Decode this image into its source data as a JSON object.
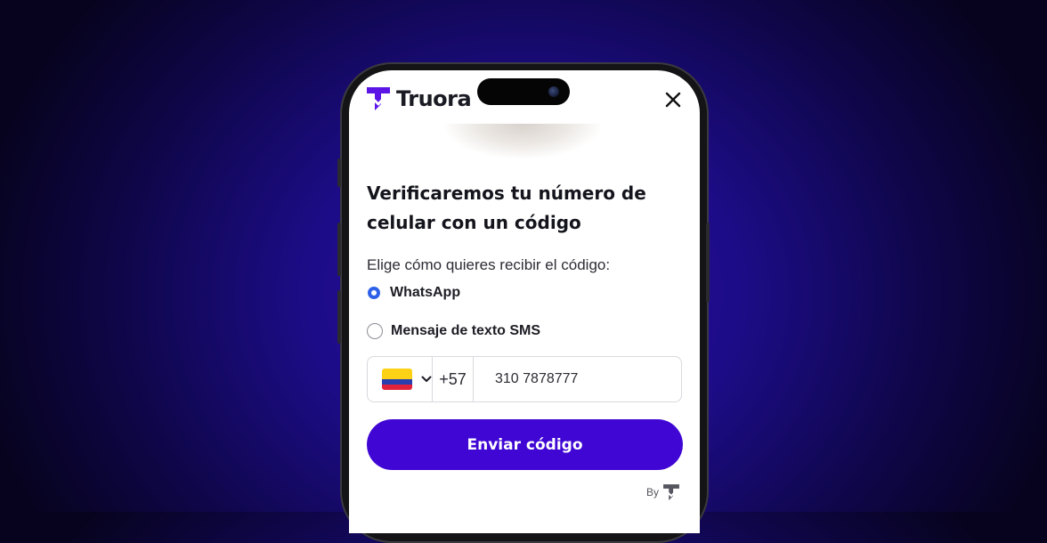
{
  "brand": {
    "name": "Truora",
    "color": "#4006d4"
  },
  "title": "Verificaremos tu número de celular con un código",
  "subtitle": "Elige cómo quieres recibir el código:",
  "options": [
    {
      "label": "WhatsApp",
      "selected": true
    },
    {
      "label": "Mensaje de texto SMS",
      "selected": false
    }
  ],
  "phone": {
    "country_flag": "colombia-flag-icon",
    "dial_code": "+57",
    "number": "310 7878777"
  },
  "submit_label": "Enviar código",
  "footer": {
    "by_label": "By"
  },
  "colors": {
    "radio_selected": "#2f61e8",
    "background": "#1c0c86"
  }
}
